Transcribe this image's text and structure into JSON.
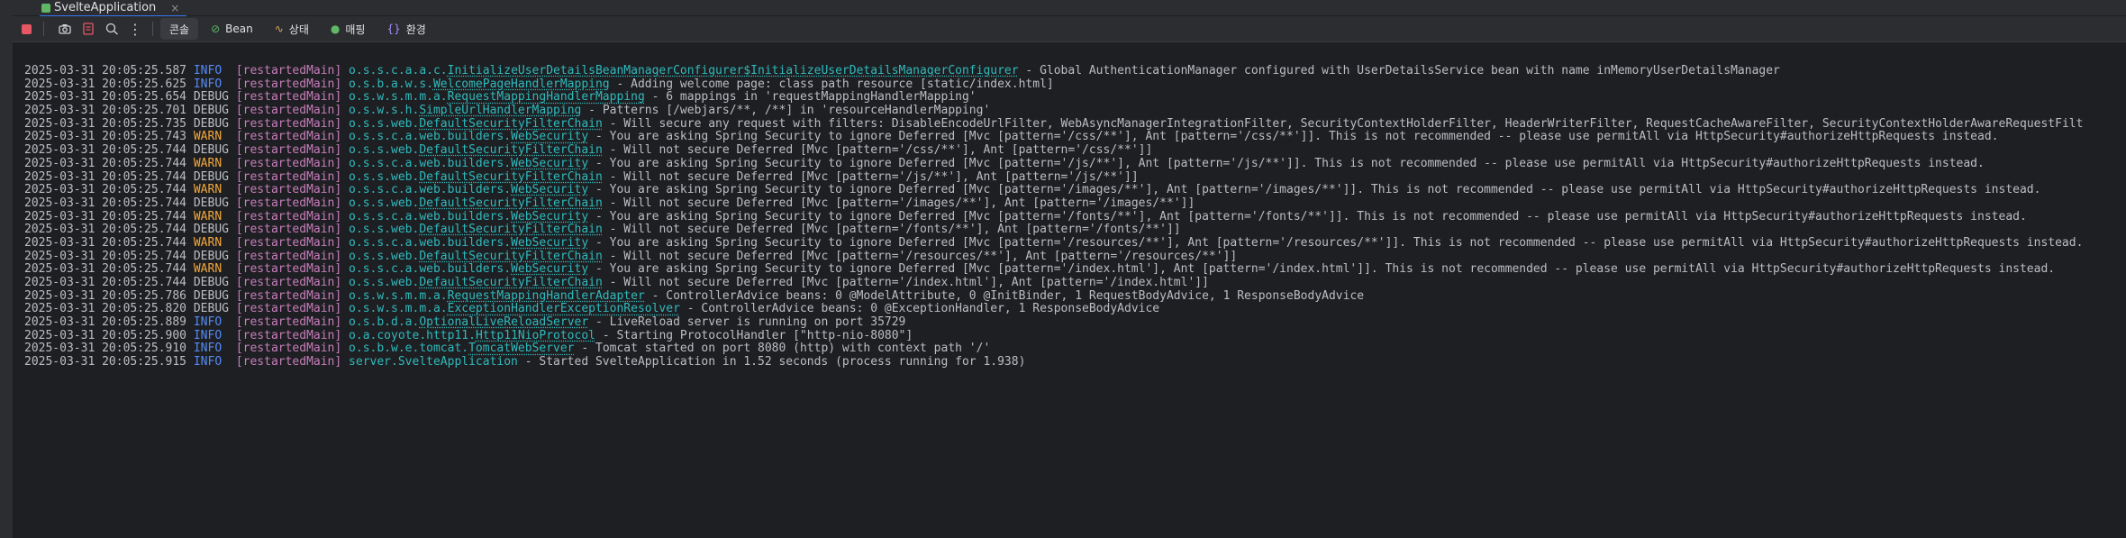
{
  "run_tab": {
    "title": "SvelteApplication",
    "close": "×"
  },
  "toolbar": {
    "tabs": [
      {
        "icon": "",
        "label": "콘솔"
      },
      {
        "icon": "⊘",
        "label": "Bean"
      },
      {
        "icon": "∿",
        "label": "상태"
      },
      {
        "icon": "●",
        "label": "매핑"
      },
      {
        "icon": "{}",
        "label": "환경"
      }
    ]
  },
  "colors": {
    "info": "#548af7",
    "warn": "#f2a73c",
    "thread": "#c77dbb",
    "logger": "#2fbabd",
    "accent": "#3574f0"
  },
  "lines": [
    {
      "ts": "2025-03-31 20:05:25.587",
      "level": "INFO",
      "thread": "[restartedMain]",
      "pkg": "o.s.s.c.a.a.c.",
      "cls": "InitializeUserDetailsBeanManagerConfigurer$InitializeUserDetailsManagerConfigurer",
      "msg": " - Global AuthenticationManager configured with UserDetailsService bean with name inMemoryUserDetailsManager"
    },
    {
      "ts": "2025-03-31 20:05:25.625",
      "level": "INFO",
      "thread": "[restartedMain]",
      "pkg": "o.s.b.a.w.s.",
      "cls": "WelcomePageHandlerMapping",
      "msg": " - Adding welcome page: class path resource [static/index.html]"
    },
    {
      "ts": "2025-03-31 20:05:25.654",
      "level": "DEBUG",
      "thread": "[restartedMain]",
      "pkg": "o.s.w.s.m.m.a.",
      "cls": "RequestMappingHandlerMapping",
      "msg": " - 6 mappings in 'requestMappingHandlerMapping'"
    },
    {
      "ts": "2025-03-31 20:05:25.701",
      "level": "DEBUG",
      "thread": "[restartedMain]",
      "pkg": "o.s.w.s.h.",
      "cls": "SimpleUrlHandlerMapping",
      "msg": " - Patterns [/webjars/**, /**] in 'resourceHandlerMapping'"
    },
    {
      "ts": "2025-03-31 20:05:25.735",
      "level": "DEBUG",
      "thread": "[restartedMain]",
      "pkg": "o.s.s.web.",
      "cls": "DefaultSecurityFilterChain",
      "msg": " - Will secure any request with filters: DisableEncodeUrlFilter, WebAsyncManagerIntegrationFilter, SecurityContextHolderFilter, HeaderWriterFilter, RequestCacheAwareFilter, SecurityContextHolderAwareRequestFilt"
    },
    {
      "ts": "2025-03-31 20:05:25.743",
      "level": "WARN",
      "thread": "[restartedMain]",
      "pkg": "o.s.s.c.a.web.builders.",
      "cls": "WebSecurity",
      "msg": " - You are asking Spring Security to ignore Deferred [Mvc [pattern='/css/**'], Ant [pattern='/css/**']]. This is not recommended -- please use permitAll via HttpSecurity#authorizeHttpRequests instead."
    },
    {
      "ts": "2025-03-31 20:05:25.744",
      "level": "DEBUG",
      "thread": "[restartedMain]",
      "pkg": "o.s.s.web.",
      "cls": "DefaultSecurityFilterChain",
      "msg": " - Will not secure Deferred [Mvc [pattern='/css/**'], Ant [pattern='/css/**']]"
    },
    {
      "ts": "2025-03-31 20:05:25.744",
      "level": "WARN",
      "thread": "[restartedMain]",
      "pkg": "o.s.s.c.a.web.builders.",
      "cls": "WebSecurity",
      "msg": " - You are asking Spring Security to ignore Deferred [Mvc [pattern='/js/**'], Ant [pattern='/js/**']]. This is not recommended -- please use permitAll via HttpSecurity#authorizeHttpRequests instead."
    },
    {
      "ts": "2025-03-31 20:05:25.744",
      "level": "DEBUG",
      "thread": "[restartedMain]",
      "pkg": "o.s.s.web.",
      "cls": "DefaultSecurityFilterChain",
      "msg": " - Will not secure Deferred [Mvc [pattern='/js/**'], Ant [pattern='/js/**']]"
    },
    {
      "ts": "2025-03-31 20:05:25.744",
      "level": "WARN",
      "thread": "[restartedMain]",
      "pkg": "o.s.s.c.a.web.builders.",
      "cls": "WebSecurity",
      "msg": " - You are asking Spring Security to ignore Deferred [Mvc [pattern='/images/**'], Ant [pattern='/images/**']]. This is not recommended -- please use permitAll via HttpSecurity#authorizeHttpRequests instead."
    },
    {
      "ts": "2025-03-31 20:05:25.744",
      "level": "DEBUG",
      "thread": "[restartedMain]",
      "pkg": "o.s.s.web.",
      "cls": "DefaultSecurityFilterChain",
      "msg": " - Will not secure Deferred [Mvc [pattern='/images/**'], Ant [pattern='/images/**']]"
    },
    {
      "ts": "2025-03-31 20:05:25.744",
      "level": "WARN",
      "thread": "[restartedMain]",
      "pkg": "o.s.s.c.a.web.builders.",
      "cls": "WebSecurity",
      "msg": " - You are asking Spring Security to ignore Deferred [Mvc [pattern='/fonts/**'], Ant [pattern='/fonts/**']]. This is not recommended -- please use permitAll via HttpSecurity#authorizeHttpRequests instead."
    },
    {
      "ts": "2025-03-31 20:05:25.744",
      "level": "DEBUG",
      "thread": "[restartedMain]",
      "pkg": "o.s.s.web.",
      "cls": "DefaultSecurityFilterChain",
      "msg": " - Will not secure Deferred [Mvc [pattern='/fonts/**'], Ant [pattern='/fonts/**']]"
    },
    {
      "ts": "2025-03-31 20:05:25.744",
      "level": "WARN",
      "thread": "[restartedMain]",
      "pkg": "o.s.s.c.a.web.builders.",
      "cls": "WebSecurity",
      "msg": " - You are asking Spring Security to ignore Deferred [Mvc [pattern='/resources/**'], Ant [pattern='/resources/**']]. This is not recommended -- please use permitAll via HttpSecurity#authorizeHttpRequests instead."
    },
    {
      "ts": "2025-03-31 20:05:25.744",
      "level": "DEBUG",
      "thread": "[restartedMain]",
      "pkg": "o.s.s.web.",
      "cls": "DefaultSecurityFilterChain",
      "msg": " - Will not secure Deferred [Mvc [pattern='/resources/**'], Ant [pattern='/resources/**']]"
    },
    {
      "ts": "2025-03-31 20:05:25.744",
      "level": "WARN",
      "thread": "[restartedMain]",
      "pkg": "o.s.s.c.a.web.builders.",
      "cls": "WebSecurity",
      "msg": " - You are asking Spring Security to ignore Deferred [Mvc [pattern='/index.html'], Ant [pattern='/index.html']]. This is not recommended -- please use permitAll via HttpSecurity#authorizeHttpRequests instead."
    },
    {
      "ts": "2025-03-31 20:05:25.744",
      "level": "DEBUG",
      "thread": "[restartedMain]",
      "pkg": "o.s.s.web.",
      "cls": "DefaultSecurityFilterChain",
      "msg": " - Will not secure Deferred [Mvc [pattern='/index.html'], Ant [pattern='/index.html']]"
    },
    {
      "ts": "2025-03-31 20:05:25.786",
      "level": "DEBUG",
      "thread": "[restartedMain]",
      "pkg": "o.s.w.s.m.m.a.",
      "cls": "RequestMappingHandlerAdapter",
      "msg": " - ControllerAdvice beans: 0 @ModelAttribute, 0 @InitBinder, 1 RequestBodyAdvice, 1 ResponseBodyAdvice"
    },
    {
      "ts": "2025-03-31 20:05:25.820",
      "level": "DEBUG",
      "thread": "[restartedMain]",
      "pkg": "o.s.w.s.m.m.a.",
      "cls": "ExceptionHandlerExceptionResolver",
      "msg": " - ControllerAdvice beans: 0 @ExceptionHandler, 1 ResponseBodyAdvice"
    },
    {
      "ts": "2025-03-31 20:05:25.889",
      "level": "INFO",
      "thread": "[restartedMain]",
      "pkg": "o.s.b.d.a.",
      "cls": "OptionalLiveReloadServer",
      "msg": " - LiveReload server is running on port 35729"
    },
    {
      "ts": "2025-03-31 20:05:25.900",
      "level": "INFO",
      "thread": "[restartedMain]",
      "pkg": "o.a.coyote.http11.",
      "cls": "Http11NioProtocol",
      "msg": " - Starting ProtocolHandler [\"http-nio-8080\"]"
    },
    {
      "ts": "2025-03-31 20:05:25.910",
      "level": "INFO",
      "thread": "[restartedMain]",
      "pkg": "o.s.b.w.e.tomcat.",
      "cls": "TomcatWebServer",
      "msg": " - Tomcat started on port 8080 (http) with context path '/'"
    },
    {
      "ts": "2025-03-31 20:05:25.915",
      "level": "INFO",
      "thread": "[restartedMain]",
      "pkg": "server.SvelteApplication",
      "cls": "",
      "msg": " - Started SvelteApplication in 1.52 seconds (process running for 1.938)"
    }
  ]
}
